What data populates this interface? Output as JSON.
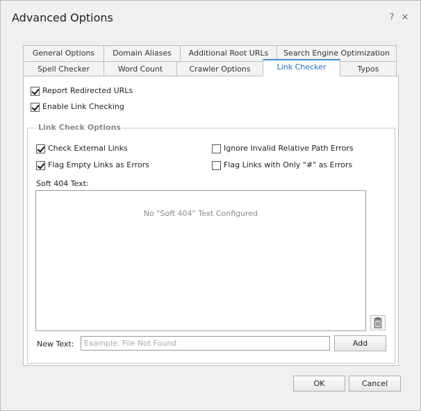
{
  "dialog": {
    "title": "Advanced Options",
    "help_glyph": "?",
    "close_glyph": "✕"
  },
  "tabs": {
    "row1": [
      {
        "label": "General Options"
      },
      {
        "label": "Domain Aliases"
      },
      {
        "label": "Additional Root URLs"
      },
      {
        "label": "Search Engine Optimization"
      }
    ],
    "row2": [
      {
        "label": "Spell Checker"
      },
      {
        "label": "Word Count"
      },
      {
        "label": "Crawler Options"
      },
      {
        "label": "Link Checker",
        "active": true
      },
      {
        "label": "Typos"
      }
    ]
  },
  "link_checker": {
    "report_redirected": {
      "label": "Report Redirected URLs",
      "checked": true
    },
    "enable_link_checking": {
      "label": "Enable Link Checking",
      "checked": true
    },
    "group_title": "Link Check Options",
    "check_external": {
      "label": "Check External Links",
      "checked": true
    },
    "flag_empty": {
      "label": "Flag Empty Links as Errors",
      "checked": true
    },
    "ignore_invalid": {
      "label": "Ignore Invalid Relative Path Errors",
      "checked": false
    },
    "flag_hash": {
      "label": "Flag Links with Only \"#\" as Errors",
      "checked": false
    },
    "soft404_label": "Soft 404 Text:",
    "soft404_empty": "No \"Soft 404\" Text Configured",
    "new_text_label": "New Text:",
    "new_text_placeholder": "Example: File Not Found",
    "new_text_value": "",
    "add_label": "Add",
    "delete_icon": "trash-icon"
  },
  "footer": {
    "ok_label": "OK",
    "cancel_label": "Cancel"
  }
}
